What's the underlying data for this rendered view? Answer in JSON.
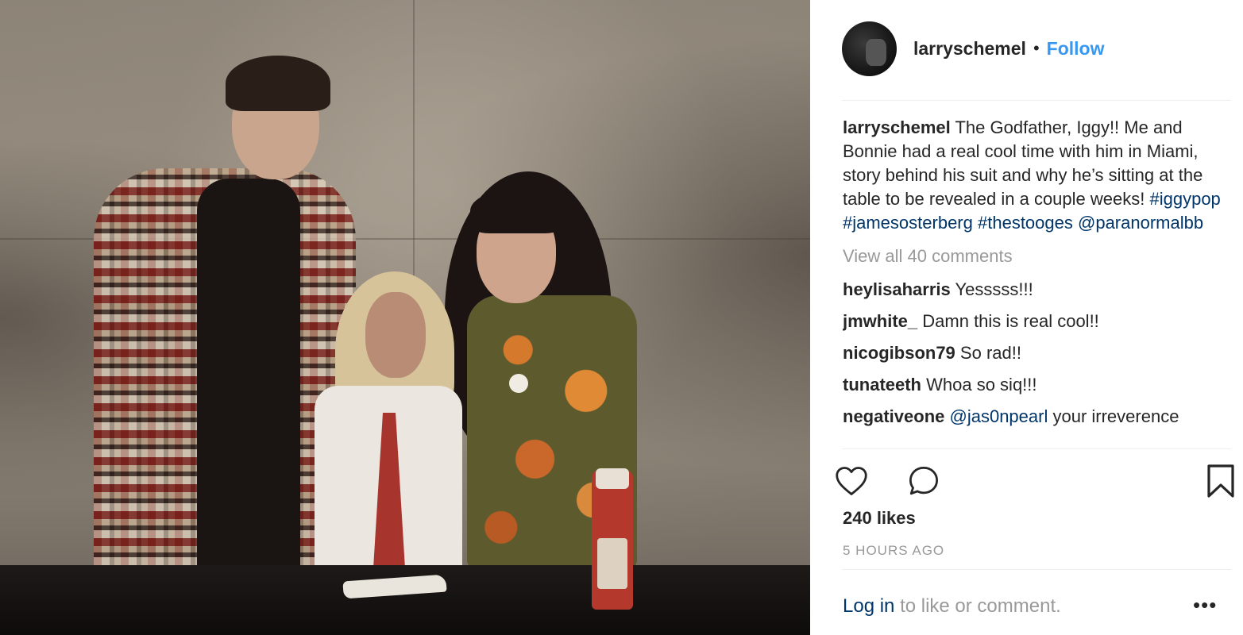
{
  "header": {
    "username": "larryschemel",
    "separator": "•",
    "follow_label": "Follow"
  },
  "caption": {
    "username": "larryschemel",
    "text": "The Godfather, Iggy!! Me and Bonnie had a real cool time with him in Miami, story behind his suit and why he’s sitting at the table to be revealed in a couple weeks!",
    "hashtags": [
      "#iggypop",
      "#jamesosterberg",
      "#thestooges"
    ],
    "mention": "@paranormalbb"
  },
  "view_all_comments": "View all 40 comments",
  "comments": [
    {
      "user": "heylisaharris",
      "text": "Yesssss!!!"
    },
    {
      "user": "jmwhite_",
      "text": "Damn this is real cool!!"
    },
    {
      "user": "nicogibson79",
      "text": "So rad!!"
    },
    {
      "user": "tunateeth",
      "text": "Whoa so siq!!!"
    },
    {
      "user": "negativeone",
      "mention": "@jas0npearl",
      "text": "your irreverence"
    }
  ],
  "actions": {
    "like_icon": "heart-icon",
    "comment_icon": "comment-icon",
    "save_icon": "bookmark-icon"
  },
  "likes": "240 likes",
  "timestamp": "5 HOURS AGO",
  "footer": {
    "login_label": "Log in",
    "login_suffix": "to like or comment.",
    "more_label": "•••"
  },
  "colors": {
    "link_blue": "#3897f0",
    "hashtag_blue": "#003569",
    "muted_gray": "#999999",
    "text": "#262626"
  }
}
